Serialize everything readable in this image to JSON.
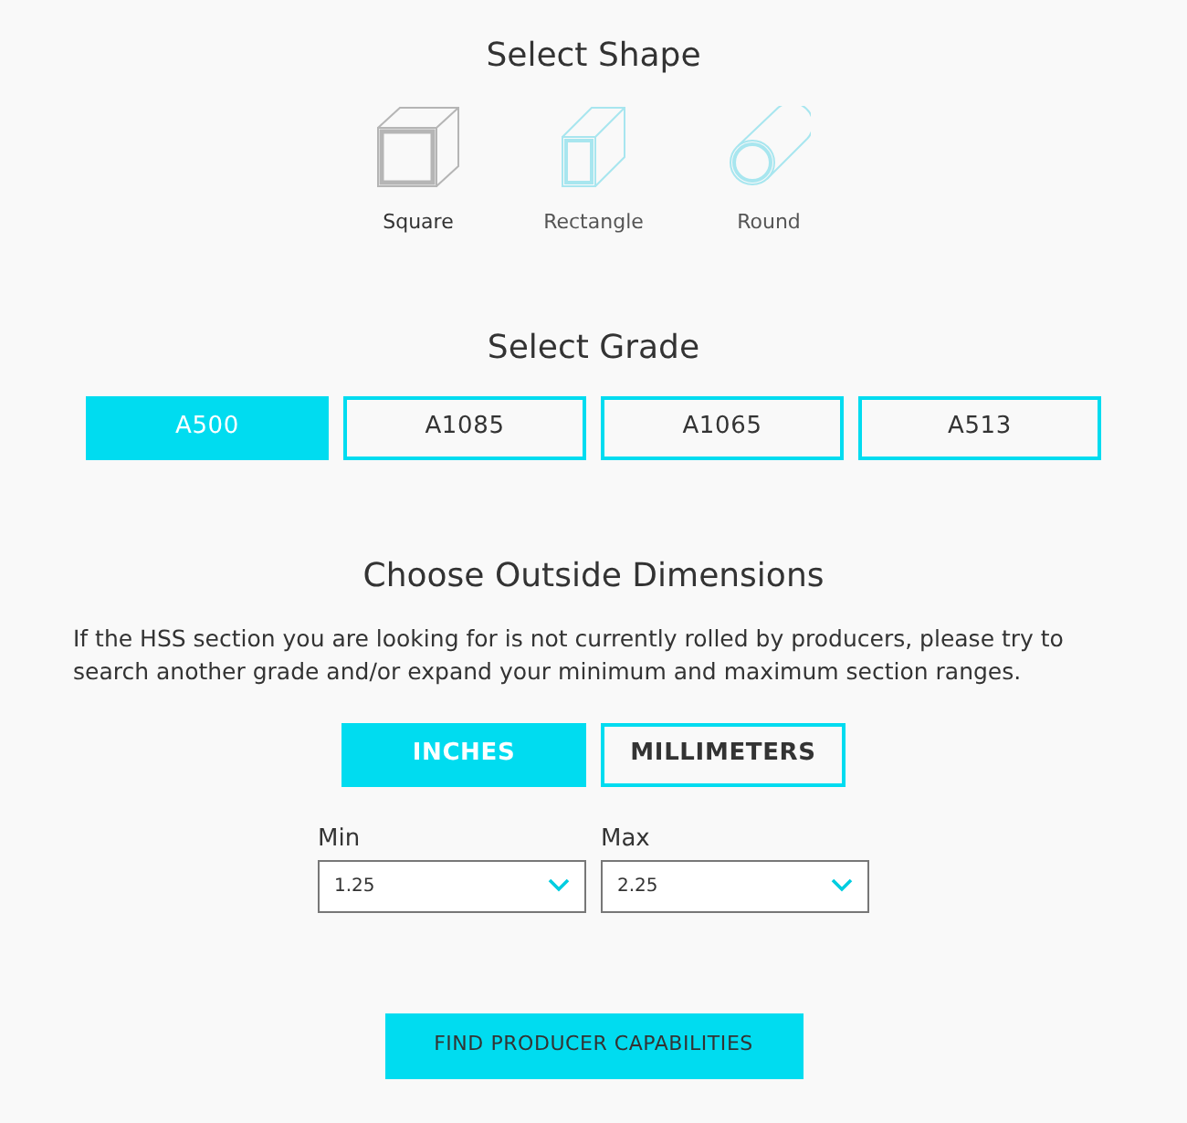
{
  "shape_section": {
    "title": "Select Shape",
    "shapes": [
      {
        "kind": "square",
        "label": "Square",
        "selected": true
      },
      {
        "kind": "rectangle",
        "label": "Rectangle",
        "selected": false
      },
      {
        "kind": "round",
        "label": "Round",
        "selected": false
      }
    ]
  },
  "grade_section": {
    "title": "Select Grade",
    "grades": [
      {
        "label": "A500",
        "selected": true
      },
      {
        "label": "A1085",
        "selected": false
      },
      {
        "label": "A1065",
        "selected": false
      },
      {
        "label": "A513",
        "selected": false
      }
    ]
  },
  "dimensions_section": {
    "title": "Choose Outside Dimensions",
    "description": "If the HSS section you are looking for is not currently rolled by producers, please try to search another grade and/or expand your minimum and maximum section ranges.",
    "units": [
      {
        "label": "INCHES",
        "selected": true
      },
      {
        "label": "MILLIMETERS",
        "selected": false
      }
    ],
    "selects": [
      {
        "label": "Min",
        "value": "1.25"
      },
      {
        "label": "Max",
        "value": "2.25"
      }
    ]
  },
  "submit_button": "FIND PRODUCER CAPABILITIES"
}
